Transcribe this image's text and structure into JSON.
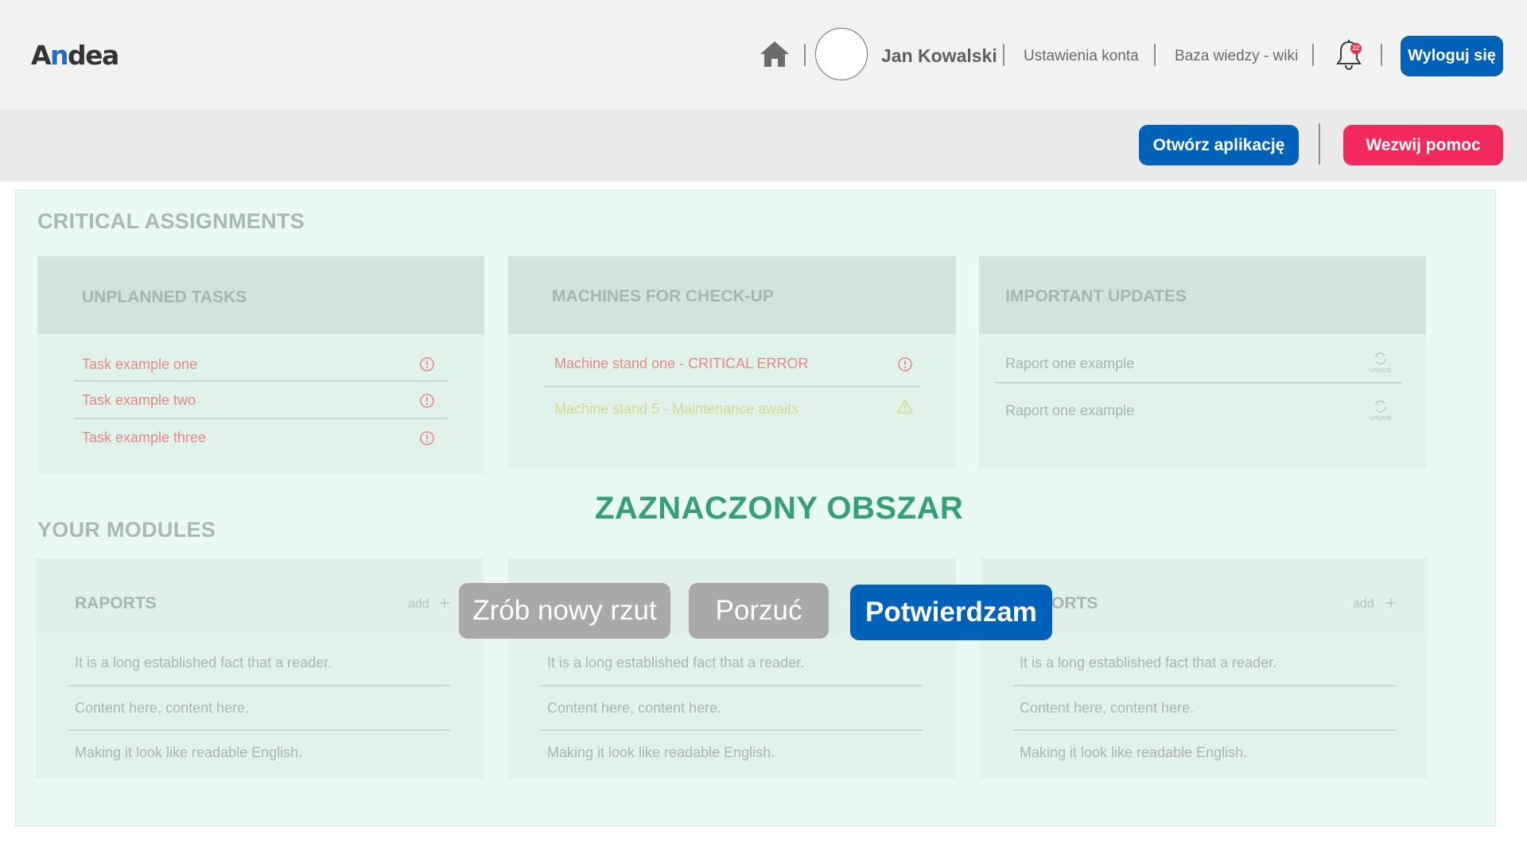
{
  "header": {
    "logo": {
      "pre": "A",
      "accent": "n",
      "post": "dea"
    },
    "user_name": "Jan Kowalski",
    "links": [
      "Ustawienia konta",
      "Baza wiedzy - wiki"
    ],
    "notifications_count": "22",
    "logout_label": "Wyloguj się"
  },
  "subheader": {
    "open_app_label": "Otwórz aplikację",
    "help_label": "Wezwij pomoc"
  },
  "critical": {
    "title": "CRITICAL ASSIGNMENTS",
    "unplanned": {
      "title": "UNPLANNED TASKS",
      "items": [
        "Task example one",
        "Task example two",
        "Task example three"
      ]
    },
    "machines": {
      "title": "MACHINES FOR CHECK-UP",
      "items": [
        "Machine stand one - CRITICAL ERROR",
        "Machine stand 5 - Maintenance awaits"
      ]
    },
    "updates": {
      "title": "IMPORTANT UPDATES",
      "items": [
        "Raport one example",
        "Raport one example"
      ],
      "update_label": "UPDATE"
    }
  },
  "modules": {
    "title": "YOUR MODULES",
    "left": {
      "title": "RAPORTS",
      "add_label": "add",
      "items": [
        "It is a long established fact that a reader.",
        "Content here, content here.",
        "Making it look like readable English."
      ]
    },
    "middle": {
      "items": [
        "It is a long established fact that a reader.",
        "Content here, content here.",
        "Making it look like readable English."
      ]
    },
    "right": {
      "title_visible": "ORTS",
      "add_label": "add",
      "items": [
        "It is a long established fact that a reader.",
        "Content here, content here.",
        "Making it look like readable English."
      ]
    }
  },
  "overlay": {
    "title": "ZAZNACZONY OBSZAR",
    "new_shot_label": "Zrób nowy rzut",
    "discard_label": "Porzuć",
    "confirm_label": "Potwierdzam"
  },
  "colors": {
    "primary": "#0261b8",
    "danger": "#f2295c",
    "area_bg": "#e8faf3",
    "overlay_title": "#35a077",
    "critical_text": "#e28a87",
    "warning_text": "#d5d98e"
  },
  "icons": [
    "home-icon",
    "bell-icon",
    "alert-circle-icon",
    "warning-triangle-icon",
    "refresh-icon",
    "plus-icon"
  ]
}
